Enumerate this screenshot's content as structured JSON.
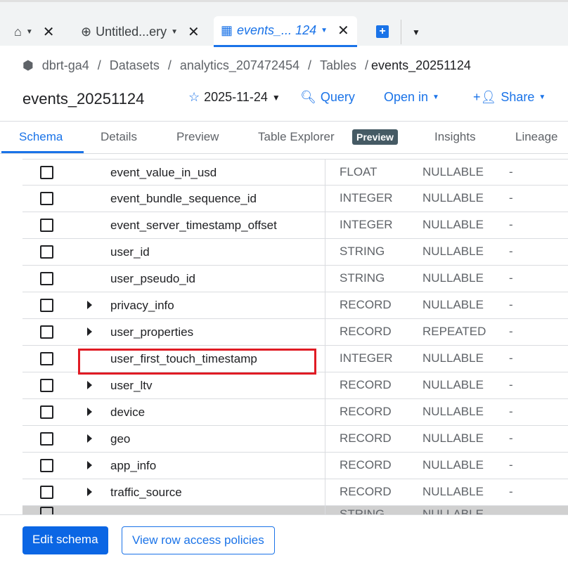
{
  "tabs": [
    {
      "label": "",
      "icon": "home-icon"
    },
    {
      "label": "Untitled...ery",
      "icon": "query-icon"
    },
    {
      "label": "events_... 124",
      "icon": "table-icon",
      "active": true
    }
  ],
  "breadcrumb": [
    "dbrt-ga4",
    "Datasets",
    "analytics_207472454",
    "Tables",
    "events_20251124"
  ],
  "title": "events_20251124",
  "actions": {
    "date": "2025-11-24",
    "query": "Query",
    "open_in": "Open in",
    "share": "Share"
  },
  "subtabs": [
    "Schema",
    "Details",
    "Preview",
    "Table Explorer",
    "Preview",
    "Insights",
    "Lineage"
  ],
  "rows": [
    {
      "name": "event_value_in_usd",
      "type": "FLOAT",
      "mode": "NULLABLE",
      "desc": "-",
      "expandable": false
    },
    {
      "name": "event_bundle_sequence_id",
      "type": "INTEGER",
      "mode": "NULLABLE",
      "desc": "-",
      "expandable": false
    },
    {
      "name": "event_server_timestamp_offset",
      "type": "INTEGER",
      "mode": "NULLABLE",
      "desc": "-",
      "expandable": false
    },
    {
      "name": "user_id",
      "type": "STRING",
      "mode": "NULLABLE",
      "desc": "-",
      "expandable": false
    },
    {
      "name": "user_pseudo_id",
      "type": "STRING",
      "mode": "NULLABLE",
      "desc": "-",
      "expandable": false
    },
    {
      "name": "privacy_info",
      "type": "RECORD",
      "mode": "NULLABLE",
      "desc": "-",
      "expandable": true
    },
    {
      "name": "user_properties",
      "type": "RECORD",
      "mode": "REPEATED",
      "desc": "-",
      "expandable": true
    },
    {
      "name": "user_first_touch_timestamp",
      "type": "INTEGER",
      "mode": "NULLABLE",
      "desc": "-",
      "expandable": false,
      "highlighted": true
    },
    {
      "name": "user_ltv",
      "type": "RECORD",
      "mode": "NULLABLE",
      "desc": "-",
      "expandable": true
    },
    {
      "name": "device",
      "type": "RECORD",
      "mode": "NULLABLE",
      "desc": "-",
      "expandable": true
    },
    {
      "name": "geo",
      "type": "RECORD",
      "mode": "NULLABLE",
      "desc": "-",
      "expandable": true
    },
    {
      "name": "app_info",
      "type": "RECORD",
      "mode": "NULLABLE",
      "desc": "-",
      "expandable": true
    },
    {
      "name": "traffic_source",
      "type": "RECORD",
      "mode": "NULLABLE",
      "desc": "-",
      "expandable": true
    }
  ],
  "partial_row": {
    "type": "STRING",
    "mode": "NULLABLE"
  },
  "footer": {
    "edit": "Edit schema",
    "row_access": "View row access policies"
  },
  "colors": {
    "accent": "#1a73e8",
    "highlight": "#e01b24",
    "badge": "#455a64"
  }
}
